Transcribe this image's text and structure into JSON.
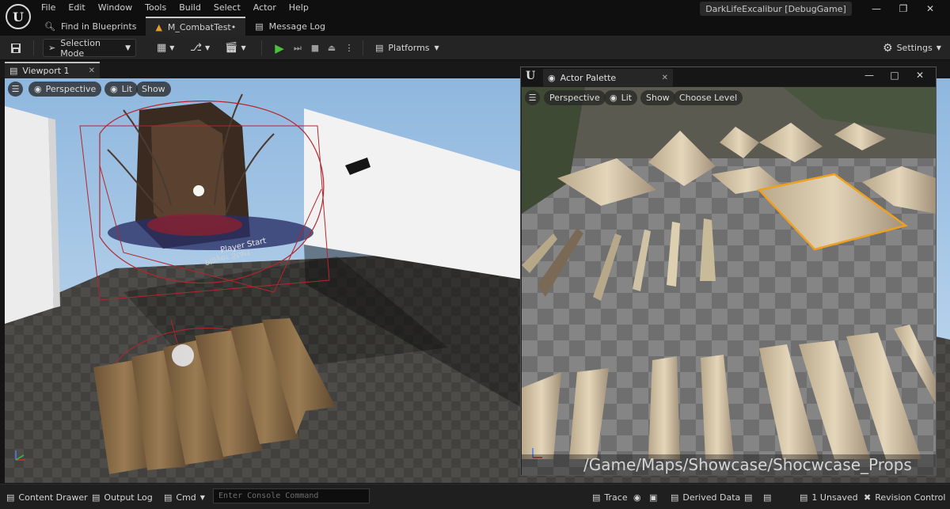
{
  "menu": [
    "File",
    "Edit",
    "Window",
    "Tools",
    "Build",
    "Select",
    "Actor",
    "Help"
  ],
  "doc_tabs": [
    {
      "label": "Find in Blueprints",
      "icon": "search-icon"
    },
    {
      "label": "M_CombatTest•",
      "icon": "level-icon"
    },
    {
      "label": "Message Log",
      "icon": "log-icon"
    }
  ],
  "project_title": "DarkLifeExcalibur [DebugGame]",
  "toolbar": {
    "mode_label": "Selection Mode",
    "platforms_label": "Platforms",
    "settings_label": "Settings"
  },
  "viewport": {
    "tab_label": "Viewport 1",
    "perspective_label": "Perspective",
    "lit_label": "Lit",
    "show_label": "Show",
    "player_start_label": "Player Start"
  },
  "palette": {
    "title": "Actor Palette",
    "perspective_label": "Perspective",
    "lit_label": "Lit",
    "show_label": "Show",
    "choose_level_label": "Choose Level",
    "path": "/Game/Maps/Showcase/Shocwcase_Props"
  },
  "statusbar": {
    "content_drawer": "Content Drawer",
    "output_log": "Output Log",
    "cmd_label": "Cmd",
    "console_placeholder": "Enter Console Command",
    "trace_label": "Trace",
    "derived_data": "Derived Data",
    "unsaved": "1 Unsaved",
    "revision_control": "Revision Control"
  },
  "colors": {
    "play_green": "#48c43c",
    "selection_orange": "#f0a020",
    "bounds_red": "#b3262b"
  }
}
